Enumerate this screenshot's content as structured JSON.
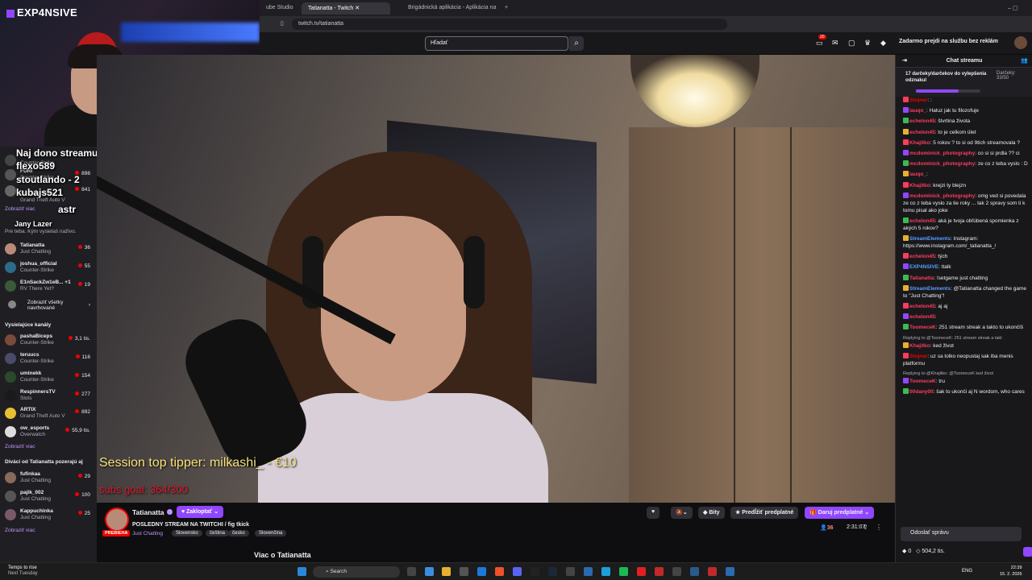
{
  "browser": {
    "tabs": [
      "ube Studio",
      "Tatianatta - Twitch",
      "Brigádnická aplikácia - Aplikácia na"
    ],
    "url": "twitch.tv/tatianatta"
  },
  "twitch": {
    "search_placeholder": "Hľadať",
    "notifications_count": "20",
    "prime_text": "Zadarmo prejdi na službu bez reklám"
  },
  "webcam": {
    "brand": "EXP4NSIVE"
  },
  "tip_overlay": [
    "Naj dono streamu: aha - €1",
    "flexo589",
    "stoutlando - 2",
    "kubajs521",
    "astr",
    "Jany Lazer"
  ],
  "sidebar": {
    "top_rows": [
      {
        "name": "",
        "game": "Counter-Strike",
        "viewers": ""
      },
      {
        "name": "FURI",
        "game": "Counter-Strike",
        "viewers": "898"
      },
      {
        "name": "",
        "game": "Counter-Strike",
        "viewers": "841"
      },
      {
        "name": "",
        "game": "Grand Theft Auto V",
        "viewers": ""
      }
    ],
    "show_more_1": "Zobraziť viac",
    "rec_note": "Pre teba. Kým vysielaš naživo.",
    "rec": [
      {
        "name": "Tatianatta",
        "game": "Just Chatting",
        "viewers": "36"
      },
      {
        "name": "joshua_official",
        "game": "Counter-Strike",
        "viewers": "55"
      },
      {
        "name": "E1nSackZw1eB... +1",
        "game": "RV There Yet?",
        "viewers": "19"
      }
    ],
    "show_all_recommended": "Zobraziť všetky navrhované",
    "section_live": "Vysielajúce kanály",
    "live": [
      {
        "name": "pashaBiceps",
        "game": "Counter-Strike",
        "viewers": "3,1 tis."
      },
      {
        "name": "teruucs",
        "game": "Counter-Strike",
        "viewers": "116"
      },
      {
        "name": "uminekk",
        "game": "Counter-Strike",
        "viewers": "154"
      },
      {
        "name": "RespinnersTV",
        "game": "Slots",
        "viewers": "277"
      },
      {
        "name": "ARTIX",
        "game": "Grand Theft Auto V",
        "viewers": "892"
      },
      {
        "name": "ow_esports",
        "game": "Overwatch",
        "viewers": "55,9 tis."
      }
    ],
    "show_more_2": "Zobraziť viac",
    "section_also": "Diváci od Tatianatta pozerajú aj",
    "also": [
      {
        "name": "fufinkaa",
        "game": "Just Chatting",
        "viewers": "29"
      },
      {
        "name": "pajik_002",
        "game": "Just Chatting",
        "viewers": "100"
      },
      {
        "name": "Kappuchinka",
        "game": "Just Chatting",
        "viewers": "25"
      }
    ],
    "show_more_3": "Zobraziť viac"
  },
  "video_overlay": {
    "top_tipper": "Session top tipper: milkashi_ - €10",
    "subs_goal": "subs goal: 364/300"
  },
  "channel": {
    "name": "Tatianatta",
    "live_badge": "PREBIEHA",
    "follow": "Zakloptať",
    "title": "POSLEDNY STREAM NA TWITCHI / fig tkick",
    "game": "Just Chatting",
    "tags": [
      "Slovensko",
      "čeština",
      "česko",
      "Slovenčina"
    ],
    "bits": "Bity",
    "extend_sub": "Predĺžiť predplatné",
    "gift_sub": "Daruj predplatné",
    "viewers": "36",
    "uptime": "2:31:07",
    "about": "Viac o Tatianatta"
  },
  "chat": {
    "header": "Chat streamu",
    "gift_text": "17 darčeky/darčekov do vylepšenia odznakul",
    "gift_label": "Darčeky:",
    "gift_count": "33/50",
    "gift_progress": 0.66,
    "messages": [
      {
        "user": "Stojner",
        "color": "#eb0400",
        "text": ":"
      },
      {
        "user": "lauqo_",
        "color": "#ff3b5c",
        "text": "Haluz jak tu filozofuje"
      },
      {
        "user": "echelon45",
        "color": "#ff3b5c",
        "text": "štvrtina života"
      },
      {
        "user": "echelon45",
        "color": "#ff3b5c",
        "text": "to je celkom ület"
      },
      {
        "user": "Khajitko",
        "color": "#ff3b5c",
        "text": "5 rokov ? to si od 9tich streamovala ?"
      },
      {
        "user": "mcdominick_photography",
        "color": "#ff3b5c",
        "text": "co si si prdla ?? ci"
      },
      {
        "user": "mcdominick_photography",
        "color": "#ff3b5c",
        "text": "ze co z teba vyslo : D"
      },
      {
        "user": "lauqo_",
        "color": "#ff3b5c",
        "text": ""
      },
      {
        "user": "Khajitko",
        "color": "#ff3b5c",
        "text": "krejzi ty blejzn"
      },
      {
        "user": "mcdominick_photography",
        "color": "#ff3b5c",
        "text": "omg ved si povedala ze co z teba vyslo za tie roky ... tak 2 spravy som ti k tomu pisal ako joke"
      },
      {
        "user": "echelon45",
        "color": "#ff3b5c",
        "text": "aká je tvoja obľúbená spomienka z akých 5 rokov?"
      },
      {
        "user": "StreamElements",
        "color": "#5c9dff",
        "text": "Instagram: https://www.instagram.com/_tatianatta_/"
      },
      {
        "user": "echelon45",
        "color": "#ff3b5c",
        "text": "tých"
      },
      {
        "user": "EXP4NSIVE",
        "color": "#5c9dff",
        "text": "ttalk"
      },
      {
        "user": "Tatianatta",
        "color": "#ff3b5c",
        "text": "!setgame just chatting"
      },
      {
        "user": "StreamElements",
        "color": "#5c9dff",
        "text": "@Tatianatta changed the game to \"Just Chatting\"!"
      },
      {
        "user": "echelon45",
        "color": "#ff3b5c",
        "text": "aj aj"
      },
      {
        "user": "echelon45",
        "color": "#ff3b5c",
        "text": ""
      },
      {
        "user": "ToomeceK",
        "color": "#ff3b5c",
        "text": "251 stream streak a takto to ukončíš"
      },
      {
        "reply": "Replying to @ToomeceK: 251 stream streak a takt",
        "user": "Khajitko",
        "color": "#ff3b5c",
        "text": "ked život"
      },
      {
        "user": "Stojner",
        "color": "#eb0400",
        "text": "uz sa tolko neopustaj sak iba menis platformu"
      },
      {
        "reply": "Replying to @Khajitko: @ToomeceK ked život",
        "user": "ToomeceK",
        "color": "#ff3b5c",
        "text": "tru"
      },
      {
        "user": "00dany00",
        "color": "#ff3b5c",
        "text": "šak to ukonči aj N wordom, who cares"
      }
    ],
    "input_placeholder": "Odoslať správu",
    "points_left": "0",
    "points": "504,2 tis."
  },
  "taskbar": {
    "weather_1": "Temps to rise",
    "weather_2": "Next Tuesday",
    "search": "Search",
    "lang": "ENG",
    "time": "22:39",
    "date": "15. 2. 2026"
  }
}
